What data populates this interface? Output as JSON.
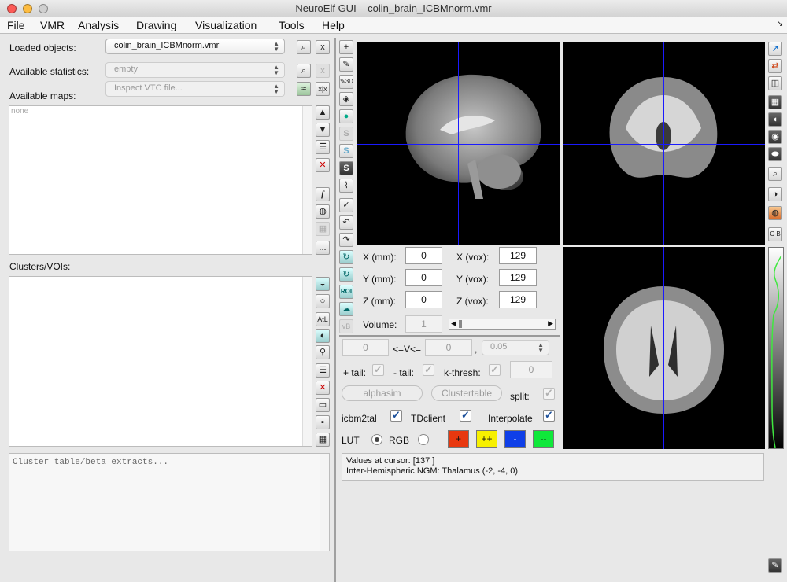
{
  "window": {
    "title": "NeuroElf GUI – colin_brain_ICBMnorm.vmr"
  },
  "menu": [
    "File",
    "VMR",
    "Analysis",
    "Drawing",
    "Visualization",
    "Tools",
    "Help"
  ],
  "left": {
    "loaded_objects_label": "Loaded objects:",
    "loaded_objects_value": "colin_brain_ICBMnorm.vmr",
    "available_statistics_label": "Available statistics:",
    "available_statistics_value": "empty",
    "available_maps_label": "Available maps:",
    "available_maps_value": "Inspect VTC file...",
    "maps_list_placeholder": "none",
    "clusters_label": "Clusters/VOIs:",
    "cluster_table_text": "Cluster table/beta extracts...",
    "close_label": "x",
    "close_all_label": "x|x"
  },
  "coords": {
    "x_mm_label": "X (mm):",
    "x_mm": "0",
    "y_mm_label": "Y (mm):",
    "y_mm": "0",
    "z_mm_label": "Z (mm):",
    "z_mm": "0",
    "x_vox_label": "X (vox):",
    "x_vox": "129",
    "y_vox_label": "Y (vox):",
    "y_vox": "129",
    "z_vox_label": "Z (vox):",
    "z_vox": "129",
    "volume_label": "Volume:",
    "volume": "1"
  },
  "thresholds": {
    "lower": "0",
    "range_label": "<=V<=",
    "upper": "0",
    "comma": ",",
    "p_value": "0.05",
    "pos_tail_label": "+ tail:",
    "neg_tail_label": "- tail:",
    "kthresh_label": "k-thresh:",
    "kthresh_value": "0",
    "alphasim_label": "alphasim",
    "clustertable_label": "Clustertable",
    "split_label": "split:"
  },
  "options": {
    "icbm2tal_label": "icbm2tal",
    "tdclient_label": "TDclient",
    "interpolate_label": "Interpolate",
    "lut_label": "LUT",
    "rgb_label": "RGB",
    "color_buttons": [
      {
        "label": "+",
        "color": "#e8380f"
      },
      {
        "label": "++",
        "color": "#f7f000"
      },
      {
        "label": "-",
        "color": "#0f3fe8"
      },
      {
        "label": "--",
        "color": "#0fe83a"
      }
    ]
  },
  "status": {
    "values_at_cursor": "Values at cursor:  [137  ]",
    "location": "Inter-Hemispheric NGM: Thalamus (-2, -4, 0)"
  },
  "tools": {
    "fn_label": "f",
    "more_label": "...",
    "atl_label": "AtL",
    "roi_label": "ROI",
    "s_label": "S",
    "vb_label": "vB",
    "cb_label": "C B",
    "threed_label": "3D"
  },
  "crosshair_color": "#1a1aff"
}
